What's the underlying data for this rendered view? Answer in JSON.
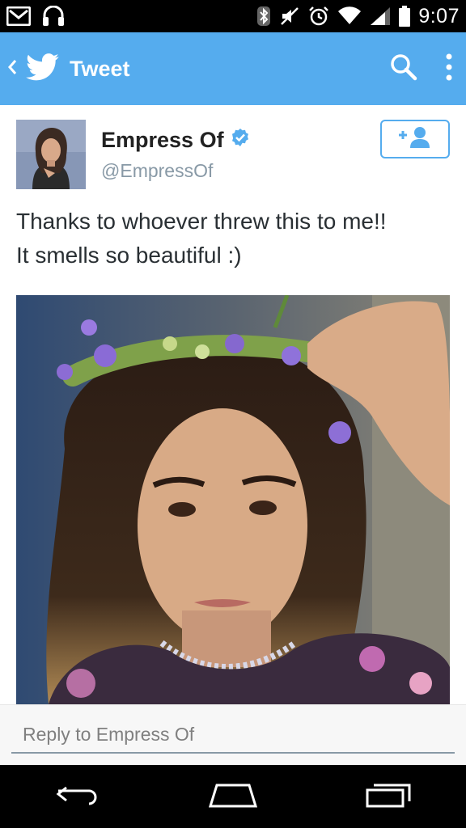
{
  "status_bar": {
    "time": "9:07",
    "left_icons": [
      "gmail-icon",
      "headset-icon"
    ],
    "right_icons": [
      "bluetooth-icon",
      "mute-icon",
      "alarm-icon",
      "wifi-icon",
      "signal-icon",
      "battery-icon"
    ]
  },
  "app_bar": {
    "title": "Tweet",
    "background": "#55acee",
    "icons": [
      "back-icon",
      "twitter-bird-icon",
      "search-icon",
      "overflow-menu-icon"
    ]
  },
  "tweet": {
    "display_name": "Empress Of",
    "handle": "@EmpressOf",
    "verified": true,
    "text_lines": [
      "Thanks to whoever threw this to me!!",
      "It smells so beautiful :)"
    ],
    "follow_icon": "follow-user-icon",
    "media_icon": "photo"
  },
  "reply": {
    "placeholder": "Reply to Empress Of"
  },
  "nav_bar": {
    "icons": [
      "back-nav-icon",
      "home-nav-icon",
      "recents-nav-icon"
    ]
  },
  "colors": {
    "accent": "#55acee",
    "verified": "#55acee",
    "text": "#292f33",
    "muted": "#8899a6"
  }
}
